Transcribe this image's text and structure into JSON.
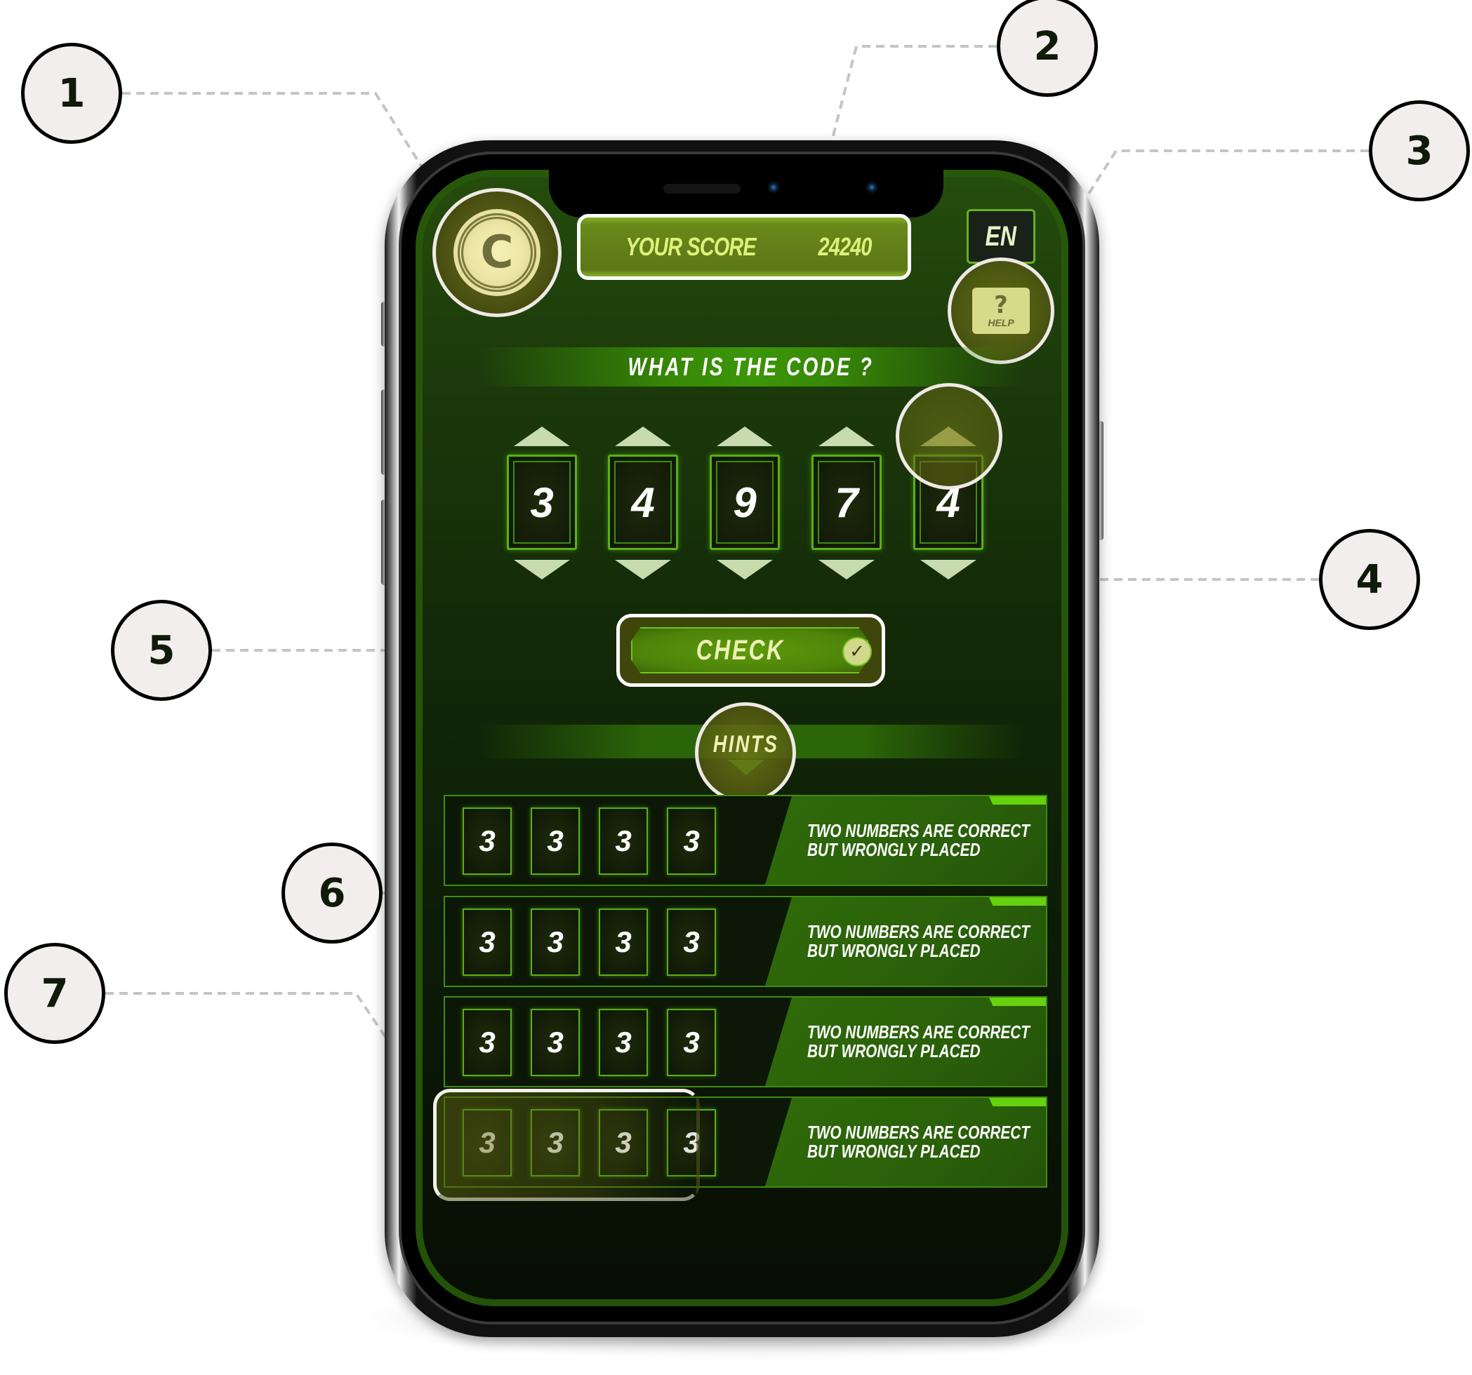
{
  "app": {
    "score_label": "YOUR SCORE",
    "score_value": "24240",
    "language": "EN",
    "help_symbol": "?",
    "help_label": "HELP",
    "coin_glyph": "C"
  },
  "code_section": {
    "title": "WHAT IS THE CODE ?",
    "digits": [
      "3",
      "4",
      "9",
      "7",
      "4"
    ]
  },
  "check_button": {
    "label": "CHECK",
    "icon_glyph": "✓"
  },
  "hints": {
    "title": "HINTS",
    "rows": [
      {
        "digits": [
          "3",
          "3",
          "3",
          "3"
        ],
        "line1": "TWO NUMBERS ARE CORRECT",
        "line2": "BUT WRONGLY PLACED"
      },
      {
        "digits": [
          "3",
          "3",
          "3",
          "3"
        ],
        "line1": "TWO NUMBERS ARE CORRECT",
        "line2": "BUT WRONGLY PLACED"
      },
      {
        "digits": [
          "3",
          "3",
          "3",
          "3"
        ],
        "line1": "TWO NUMBERS ARE CORRECT",
        "line2": "BUT WRONGLY PLACED"
      },
      {
        "digits": [
          "3",
          "3",
          "3",
          "3"
        ],
        "line1": "TWO NUMBERS ARE CORRECT",
        "line2": "BUT WRONGLY PLACED"
      }
    ]
  },
  "annotations": [
    "1",
    "2",
    "3",
    "4",
    "5",
    "6",
    "7"
  ],
  "colors": {
    "accent_green": "#59b015",
    "panel_green": "#2a600a",
    "score_text": "#dcf27a",
    "callout_bg": "#f1eeed"
  }
}
